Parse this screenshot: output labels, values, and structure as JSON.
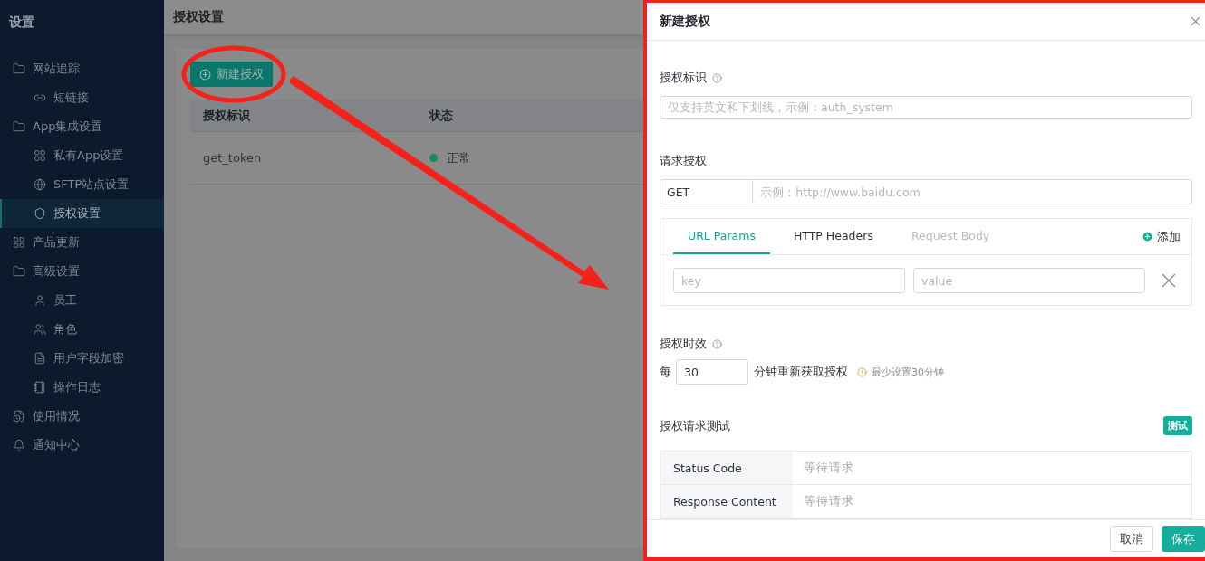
{
  "sidebar": {
    "title": "设置",
    "items": [
      {
        "label": "网站追踪",
        "selected": false,
        "children": [
          {
            "label": "短链接",
            "selected": false
          }
        ]
      },
      {
        "label": "App集成设置",
        "selected": false,
        "children": [
          {
            "label": "私有App设置",
            "selected": false
          },
          {
            "label": "SFTP站点设置",
            "selected": false
          },
          {
            "label": "授权设置",
            "selected": true
          }
        ]
      },
      {
        "label": "产品更新",
        "selected": false
      },
      {
        "label": "高级设置",
        "selected": false,
        "children": [
          {
            "label": "员工",
            "selected": false
          },
          {
            "label": "角色",
            "selected": false
          },
          {
            "label": "用户字段加密",
            "selected": false
          },
          {
            "label": "操作日志",
            "selected": false
          }
        ]
      },
      {
        "label": "使用情况",
        "selected": false
      },
      {
        "label": "通知中心",
        "selected": false
      }
    ]
  },
  "main": {
    "title": "授权设置",
    "new_button": "新建授权",
    "table": {
      "columns": [
        "授权标识",
        "状态"
      ],
      "rows": [
        {
          "id": "get_token",
          "status": "正常",
          "color": "#1a8a50"
        }
      ]
    }
  },
  "drawer": {
    "title": "新建授权",
    "auth_id": {
      "label": "授权标识",
      "placeholder": "仅支持英文和下划线，示例：auth_system"
    },
    "request": {
      "label": "请求授权",
      "method": "GET",
      "url_placeholder": "示例：http://www.baidu.com",
      "tabs": [
        {
          "label": "URL Params",
          "selected": true,
          "disabled": false
        },
        {
          "label": "HTTP Headers",
          "selected": false,
          "disabled": false
        },
        {
          "label": "Request Body",
          "selected": false,
          "disabled": true
        }
      ],
      "add": "添加",
      "key_placeholder": "key",
      "value_placeholder": "value"
    },
    "validity": {
      "label": "授权时效",
      "prefix": "每",
      "value": "30",
      "suffix": "分钟重新获取授权",
      "hint": "最少设置30分钟"
    },
    "test": {
      "label": "授权请求测试",
      "button": "测试",
      "rows": [
        {
          "name": "Status Code",
          "value": "等待请求"
        },
        {
          "name": "Response Content",
          "value": "等待请求"
        }
      ]
    },
    "buttons": {
      "cancel": "取消",
      "save": "保存"
    }
  }
}
